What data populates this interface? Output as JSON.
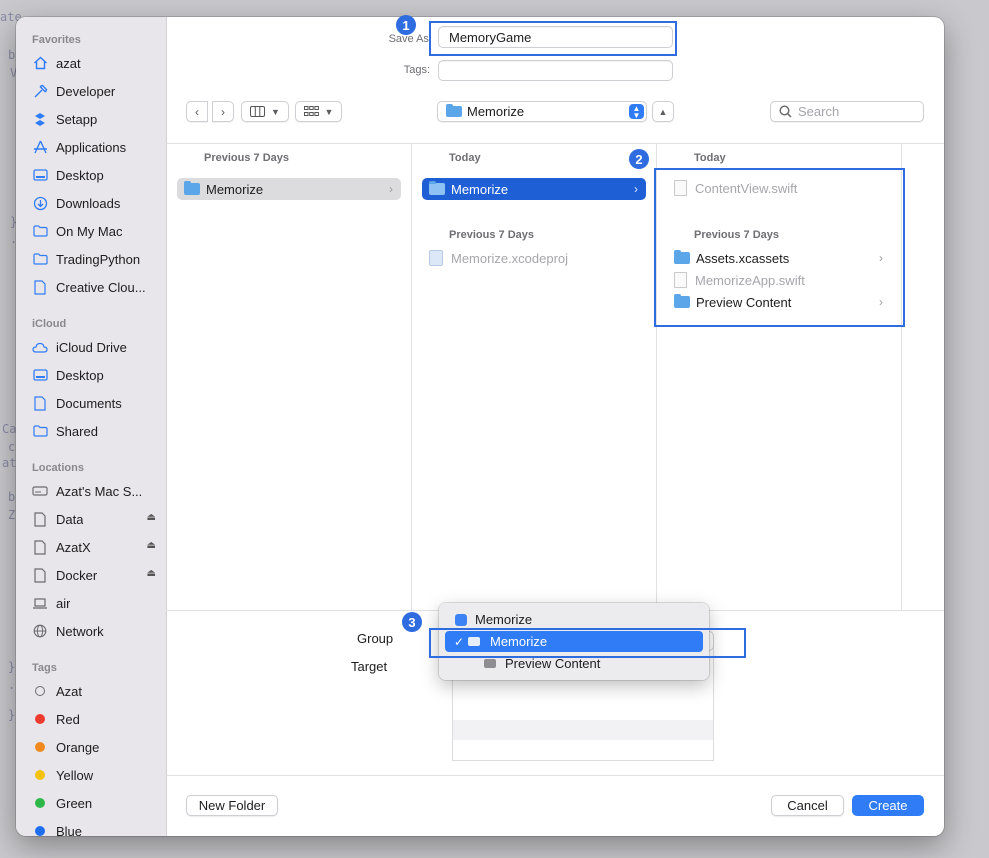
{
  "background": {
    "code_fragments": [
      "ate",
      "b",
      "V",
      "}",
      ".",
      "Ca",
      "c",
      "at",
      "b",
      "Z",
      "}",
      ".",
      "}"
    ]
  },
  "dialog": {
    "save_as_label": "Save As:",
    "save_as_value": "MemoryGame",
    "tags_label": "Tags:",
    "tags_value": "",
    "location_name": "Memorize",
    "search_placeholder": "Search"
  },
  "sidebar": {
    "sections": [
      {
        "title": "Favorites",
        "items": [
          {
            "label": "azat",
            "icon": "home-icon"
          },
          {
            "label": "Developer",
            "icon": "hammer-icon"
          },
          {
            "label": "Setapp",
            "icon": "setapp-icon"
          },
          {
            "label": "Applications",
            "icon": "applications-icon"
          },
          {
            "label": "Desktop",
            "icon": "desktop-icon"
          },
          {
            "label": "Downloads",
            "icon": "downloads-icon"
          },
          {
            "label": "On My Mac",
            "icon": "folder-icon"
          },
          {
            "label": "TradingPython",
            "icon": "folder-icon"
          },
          {
            "label": "Creative Clou...",
            "icon": "document-icon"
          }
        ]
      },
      {
        "title": "iCloud",
        "items": [
          {
            "label": "iCloud Drive",
            "icon": "cloud-icon"
          },
          {
            "label": "Desktop",
            "icon": "desktop-icon"
          },
          {
            "label": "Documents",
            "icon": "document-icon"
          },
          {
            "label": "Shared",
            "icon": "shared-folder-icon"
          }
        ]
      },
      {
        "title": "Locations",
        "items": [
          {
            "label": "Azat's Mac S...",
            "icon": "drive-icon"
          },
          {
            "label": "Data",
            "icon": "document-icon",
            "eject": true
          },
          {
            "label": "AzatX",
            "icon": "document-icon",
            "eject": true
          },
          {
            "label": "Docker",
            "icon": "document-icon",
            "eject": true
          },
          {
            "label": "air",
            "icon": "laptop-icon"
          },
          {
            "label": "Network",
            "icon": "globe-icon"
          }
        ]
      },
      {
        "title": "Tags",
        "items": [
          {
            "label": "Azat",
            "color": "#ffffff"
          },
          {
            "label": "Red",
            "color": "#ee3b30"
          },
          {
            "label": "Orange",
            "color": "#f08a1e"
          },
          {
            "label": "Yellow",
            "color": "#f4c20d"
          },
          {
            "label": "Green",
            "color": "#2fb84a"
          },
          {
            "label": "Blue",
            "color": "#1f6ef0"
          }
        ]
      }
    ]
  },
  "columns": [
    {
      "sections": [
        {
          "header": "Previous 7 Days",
          "items": [
            {
              "label": "Memorize",
              "type": "folder",
              "state": "selected-inactive",
              "chevron": true
            }
          ]
        }
      ]
    },
    {
      "sections": [
        {
          "header": "Today",
          "items": [
            {
              "label": "Memorize",
              "type": "folder",
              "state": "selected-active",
              "chevron": true
            }
          ]
        },
        {
          "header": "Previous 7 Days",
          "items": [
            {
              "label": "Memorize.xcodeproj",
              "type": "project",
              "state": "dimmed"
            }
          ]
        }
      ]
    },
    {
      "sections": [
        {
          "header": "Today",
          "items": [
            {
              "label": "ContentView.swift",
              "type": "file",
              "state": "dimmed"
            }
          ]
        },
        {
          "header": "Previous 7 Days",
          "items": [
            {
              "label": "Assets.xcassets",
              "type": "folder",
              "state": "normal",
              "chevron": true
            },
            {
              "label": "MemorizeApp.swift",
              "type": "file",
              "state": "dimmed"
            },
            {
              "label": "Preview Content",
              "type": "folder",
              "state": "normal",
              "chevron": true
            }
          ]
        }
      ]
    }
  ],
  "options": {
    "group_label": "Group",
    "targets_label": "Target",
    "popup_items": [
      {
        "label": "Memorize",
        "icon": "app-icon",
        "checked": false
      },
      {
        "label": "Memorize",
        "icon": "folder-icon",
        "checked": true
      },
      {
        "label": "Preview Content",
        "icon": "folder-icon",
        "checked": false
      }
    ],
    "checkmark": "✓"
  },
  "annotations": [
    {
      "number": "1"
    },
    {
      "number": "2"
    },
    {
      "number": "3"
    }
  ],
  "footer": {
    "new_folder": "New Folder",
    "cancel": "Cancel",
    "create": "Create"
  },
  "colors": {
    "accent": "#2e6ce0",
    "selection": "#1f5fd6",
    "create_button": "#2f7cf6"
  }
}
